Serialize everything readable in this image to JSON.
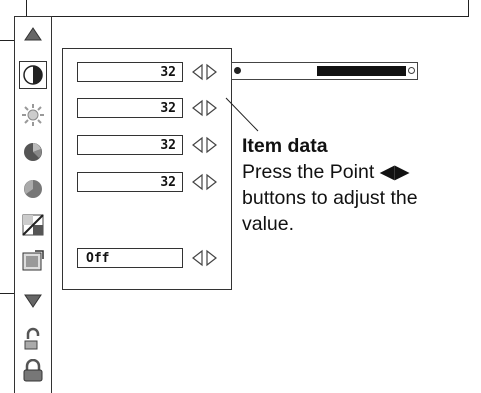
{
  "menu_icons": [
    {
      "name": "scroll-up-arrow-icon"
    },
    {
      "name": "contrast-icon",
      "selected": true
    },
    {
      "name": "brightness-icon"
    },
    {
      "name": "color-icon"
    },
    {
      "name": "tint-icon"
    },
    {
      "name": "sharpness-icon"
    },
    {
      "name": "image-reset-icon"
    },
    {
      "name": "scroll-down-arrow-icon"
    },
    {
      "name": "store-icon"
    },
    {
      "name": "lock-icon"
    }
  ],
  "items": [
    {
      "value": "32"
    },
    {
      "value": "32"
    },
    {
      "value": "32"
    },
    {
      "value": "32"
    },
    {
      "value": "Off"
    }
  ],
  "slider": {
    "value_fraction": 0.45
  },
  "caption": {
    "title": "Item data",
    "line1": "Press the Point ◀▶",
    "line2": "buttons to adjust the",
    "line3": "value."
  }
}
